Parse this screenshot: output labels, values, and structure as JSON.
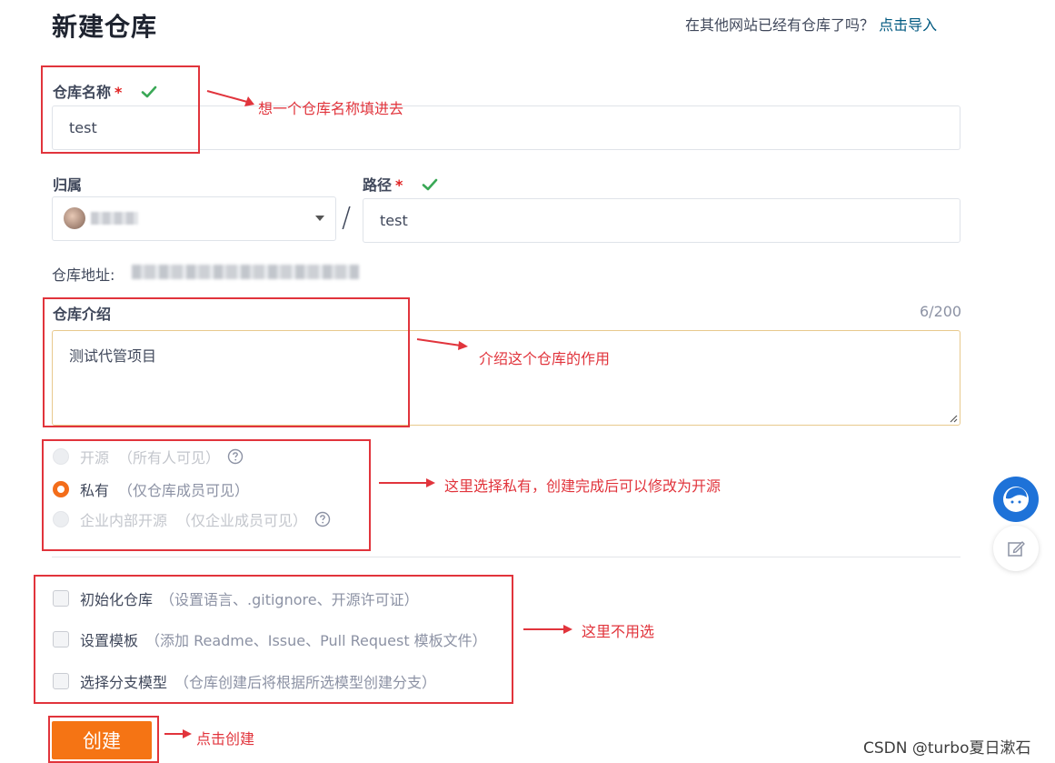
{
  "page": {
    "title": "新建仓库",
    "import_prompt": "在其他网站已经有仓库了吗？",
    "import_link": "点击导入"
  },
  "form": {
    "repo_name": {
      "label": "仓库名称",
      "required_mark": "*",
      "value": "test"
    },
    "owner": {
      "label": "归属"
    },
    "path_separator": "/",
    "path": {
      "label": "路径",
      "required_mark": "*",
      "value": "test"
    },
    "repo_address": {
      "label": "仓库地址:"
    },
    "description": {
      "label": "仓库介绍",
      "counter": "6/200",
      "value": "测试代管项目"
    },
    "visibility": {
      "options": [
        {
          "label": "开源",
          "hint": "（所有人可见）",
          "selected": false,
          "disabled": true,
          "help": true
        },
        {
          "label": "私有",
          "hint": "（仅仓库成员可见）",
          "selected": true,
          "disabled": false,
          "help": false
        },
        {
          "label": "企业内部开源",
          "hint": "（仅企业成员可见）",
          "selected": false,
          "disabled": true,
          "help": true
        }
      ]
    },
    "extras": [
      {
        "label": "初始化仓库",
        "hint": "（设置语言、.gitignore、开源许可证）",
        "checked": false
      },
      {
        "label": "设置模板",
        "hint": "（添加 Readme、Issue、Pull Request 模板文件）",
        "checked": false
      },
      {
        "label": "选择分支模型",
        "hint": "（仓库创建后将根据所选模型创建分支）",
        "checked": false
      }
    ],
    "submit_label": "创建"
  },
  "annotations": {
    "name": "想一个仓库名称填进去",
    "description": "介绍这个仓库的作用",
    "visibility": "这里选择私有，创建完成后可以修改为开源",
    "extras": "这里不用选",
    "submit": "点击创建"
  },
  "watermark": "CSDN @turbo夏日漱石",
  "colors": {
    "accent": "#f57414",
    "link": "#005980",
    "success": "#3aa856",
    "annotation": "#e1343c"
  },
  "icons": [
    "check-icon",
    "caret-down-icon",
    "help-icon",
    "assistant-avatar-icon",
    "edit-icon"
  ]
}
